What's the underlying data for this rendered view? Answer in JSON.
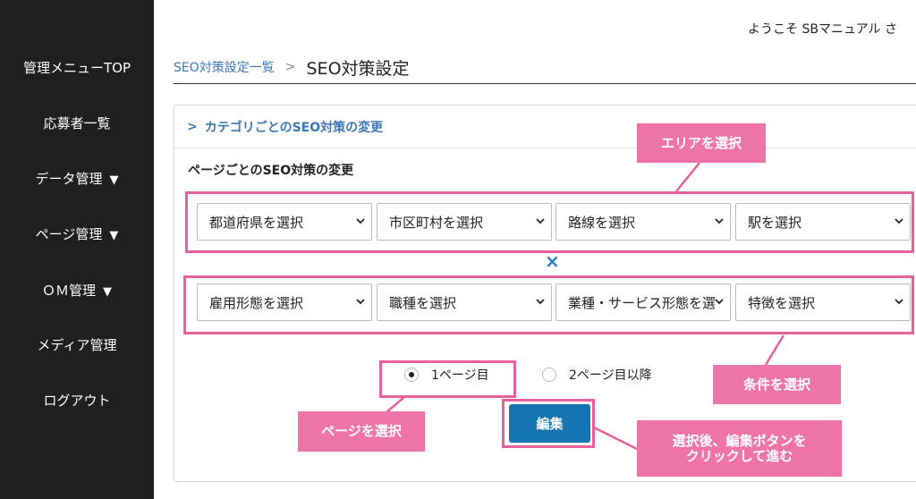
{
  "header": {
    "greeting": "ようこそ SBマニュアル さ"
  },
  "sidebar": {
    "items": [
      {
        "label": "管理メニューTOP",
        "arrow": ""
      },
      {
        "label": "応募者一覧",
        "arrow": ""
      },
      {
        "label": "データ管理",
        "arrow": "▼"
      },
      {
        "label": "ページ管理",
        "arrow": "▼"
      },
      {
        "label": "ＯＭ管理",
        "arrow": "▼"
      },
      {
        "label": "メディア管理",
        "arrow": ""
      },
      {
        "label": "ログアウト",
        "arrow": ""
      }
    ]
  },
  "breadcrumb": {
    "link": "SEO対策設定一覧",
    "separator": ">",
    "current": "SEO対策設定"
  },
  "panel": {
    "header": "カテゴリごとのSEO対策の変更",
    "section_title": "ページごとのSEO対策の変更",
    "area_selects": [
      "都道府県を選択",
      "市区町村を選択",
      "路線を選択",
      "駅を選択"
    ],
    "multiply_symbol": "×",
    "condition_selects": [
      "雇用形態を選択",
      "職種を選択",
      "業種・サービス形態を選択",
      "特徴を選択"
    ],
    "radios": [
      {
        "label": "1ページ目",
        "checked": true
      },
      {
        "label": "2ページ目以降",
        "checked": false
      }
    ],
    "edit_button": "編集"
  },
  "annotations": {
    "area": "エリアを選択",
    "condition": "条件を選択",
    "page": "ページを選択",
    "edit_line1": "選択後、編集ボタンを",
    "edit_line2": "クリックして進む"
  },
  "colors": {
    "sidebar_bg": "#1f1f1f",
    "link": "#3a78b5",
    "annotation": "#ee74a8",
    "annotation_border": "#e8609b",
    "button": "#1575b3"
  }
}
